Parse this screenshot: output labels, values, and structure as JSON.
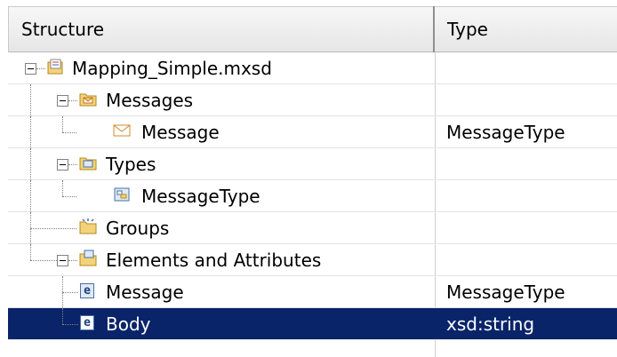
{
  "columns": {
    "structure": "Structure",
    "type": "Type"
  },
  "rows": [
    {
      "label": "Mapping_Simple.mxsd",
      "type": "",
      "icon": "schema-file-icon"
    },
    {
      "label": "Messages",
      "type": "",
      "icon": "messages-folder-icon"
    },
    {
      "label": "Message",
      "type": "MessageType",
      "icon": "envelope-icon"
    },
    {
      "label": "Types",
      "type": "",
      "icon": "types-folder-icon"
    },
    {
      "label": "MessageType",
      "type": "",
      "icon": "complex-type-icon"
    },
    {
      "label": "Groups",
      "type": "",
      "icon": "groups-folder-icon"
    },
    {
      "label": "Elements and Attributes",
      "type": "",
      "icon": "elements-folder-icon"
    },
    {
      "label": "Message",
      "type": "MessageType",
      "icon": "element-e-icon"
    },
    {
      "label": "Body",
      "type": "xsd:string",
      "icon": "element-e-icon",
      "selected": true
    }
  ],
  "colors": {
    "selection": "#0a246a",
    "header_bg": "#eeeeee"
  }
}
